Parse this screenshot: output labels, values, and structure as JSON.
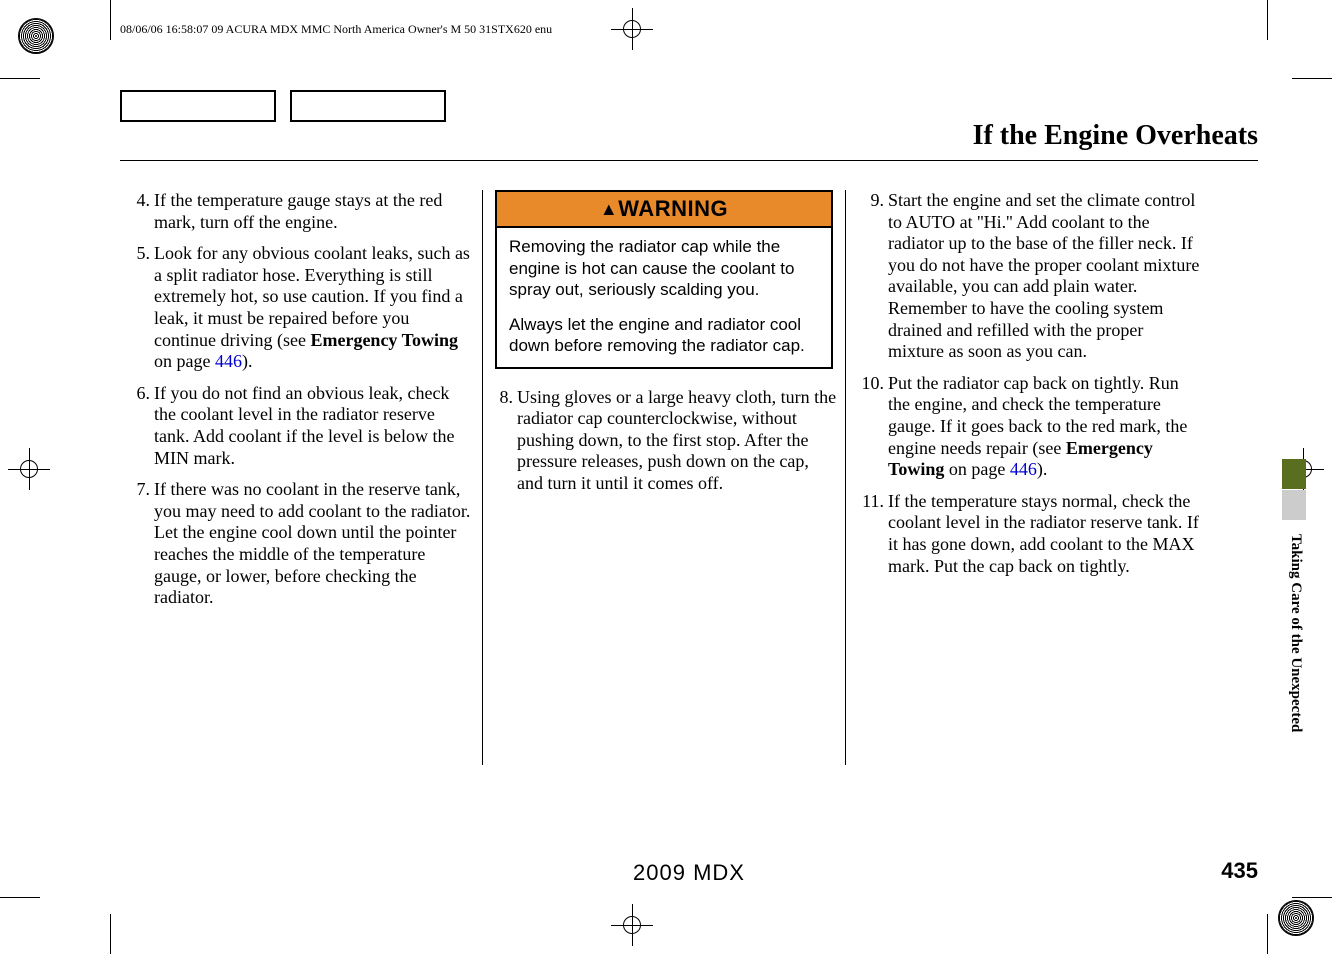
{
  "meta": {
    "header": "08/06/06 16:58:07   09 ACURA MDX MMC North America Owner's M 50 31STX620 enu"
  },
  "title": "If the Engine Overheats",
  "warning": {
    "label": "WARNING",
    "p1": "Removing the radiator cap while the engine is hot can cause the coolant to spray out, seriously scalding you.",
    "p2": "Always let the engine and radiator cool down before removing the radiator cap."
  },
  "steps": {
    "s4": {
      "n": "4.",
      "t1": "If the temperature gauge stays at the red mark, turn off the engine."
    },
    "s5": {
      "n": "5.",
      "t1": "Look for any obvious coolant leaks, such as a split radiator hose. Everything is still extremely hot, so use caution. If you find a leak, it must be repaired before you continue driving (see ",
      "b1": "Emergency Towing",
      "t2": " on page ",
      "l1": "446",
      "t3": ")."
    },
    "s6": {
      "n": "6.",
      "t1": "If you do not find an obvious leak, check the coolant level in the radiator reserve tank. Add coolant if the level is below the MIN mark."
    },
    "s7": {
      "n": "7.",
      "t1": "If there was no coolant in the reserve tank, you may need to add coolant to the radiator. Let the engine cool down until the pointer reaches the middle of the temperature gauge, or lower, before checking the radiator."
    },
    "s8": {
      "n": "8.",
      "t1": "Using gloves or a large heavy cloth, turn the radiator cap counterclockwise, without pushing down, to the first stop. After the pressure releases, push down on the cap, and turn it until it comes off."
    },
    "s9": {
      "n": "9.",
      "t1": "Start the engine and set the climate control to AUTO at ''Hi.'' Add coolant to the radiator up to the base of the filler neck. If you do not have the proper coolant mixture available, you can add plain water. Remember to have the cooling system drained and refilled with the proper mixture as soon as you can."
    },
    "s10": {
      "n": "10.",
      "t1": "Put the radiator cap back on tightly. Run the engine, and check the temperature gauge. If it goes back to the red mark, the engine needs repair (see ",
      "b1": "Emergency Towing",
      "t2": " on page ",
      "l1": "446",
      "t3": ")."
    },
    "s11": {
      "n": "11.",
      "t1": "If the temperature stays normal, check the coolant level in the radiator reserve tank. If it has gone down, add coolant to the MAX mark. Put the cap back on tightly."
    }
  },
  "side_label": "Taking Care of the Unexpected",
  "footer": {
    "model": "2009  MDX",
    "page": "435"
  }
}
